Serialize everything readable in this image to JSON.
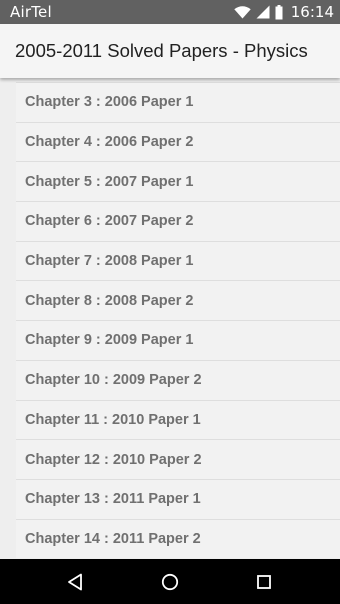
{
  "status_bar": {
    "carrier": "AirTel",
    "time": "16:14",
    "icons": [
      "wifi-icon",
      "cell-signal-icon",
      "battery-icon"
    ]
  },
  "app_bar": {
    "title": "2005-2011 Solved Papers - Physics"
  },
  "chapters": [
    "Chapter 3 : 2006 Paper 1",
    "Chapter 4 : 2006 Paper 2",
    "Chapter 5 : 2007 Paper 1",
    "Chapter 6 : 2007 Paper 2",
    "Chapter 7 : 2008 Paper 1",
    "Chapter 8 : 2008 Paper 2",
    "Chapter 9 : 2009 Paper 1",
    "Chapter 10 : 2009 Paper 2",
    "Chapter 11 : 2010 Paper 1",
    "Chapter 12 : 2010 Paper 2",
    "Chapter 13 : 2011 Paper 1",
    "Chapter 14 : 2011 Paper 2"
  ],
  "nav_bar": {
    "icons": [
      "back-icon",
      "home-icon",
      "recents-icon"
    ]
  },
  "colors": {
    "status_bar_bg": "#616161",
    "app_bar_bg": "#f5f5f5",
    "list_bg": "#f2f2f2",
    "list_text": "#707070",
    "nav_bar_bg": "#000000"
  }
}
